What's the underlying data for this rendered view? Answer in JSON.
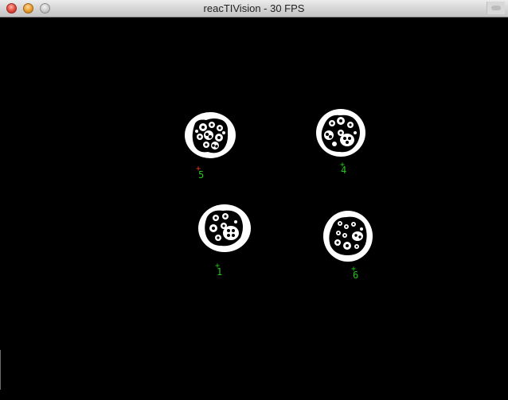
{
  "window": {
    "title": "reacTIVision - 30 FPS"
  },
  "fiducials": [
    {
      "id": "5",
      "cross": "+",
      "cross_color": "#e53b2b"
    },
    {
      "id": "4",
      "cross": "+",
      "cross_color": "#24c41f"
    },
    {
      "id": "1",
      "cross": "+",
      "cross_color": "#24c41f"
    },
    {
      "id": "6",
      "cross": "+",
      "cross_color": "#24c41f"
    }
  ],
  "colors": {
    "label": "#24c41f",
    "background": "#000000",
    "marker": "#ffffff"
  }
}
